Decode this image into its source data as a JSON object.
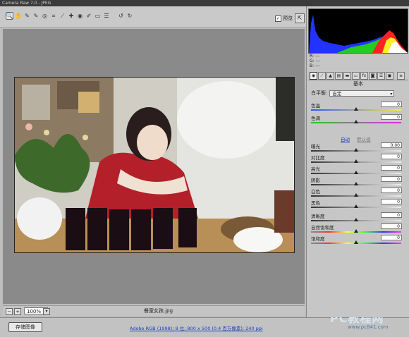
{
  "app": {
    "title": "Camera Raw 7.0 - JPEG"
  },
  "toolbar": {
    "tools": [
      {
        "icon": "zoom-icon",
        "glyph": "🔍",
        "selected": true
      },
      {
        "icon": "hand-icon",
        "glyph": "✋"
      },
      {
        "icon": "white-balance-icon",
        "glyph": "✎"
      },
      {
        "icon": "color-sampler-icon",
        "glyph": "✎"
      },
      {
        "icon": "target-adjust-icon",
        "glyph": "◎"
      },
      {
        "icon": "crop-icon",
        "glyph": "⌗"
      },
      {
        "icon": "straighten-icon",
        "glyph": "⟋"
      },
      {
        "icon": "spot-removal-icon",
        "glyph": "✚"
      },
      {
        "icon": "red-eye-icon",
        "glyph": "◉"
      },
      {
        "icon": "adjustment-brush-icon",
        "glyph": "✐"
      },
      {
        "icon": "graduated-filter-icon",
        "glyph": "▭"
      },
      {
        "icon": "preferences-icon",
        "glyph": "☰"
      },
      {
        "icon": "rotate-ccw-icon",
        "glyph": "↺"
      },
      {
        "icon": "rotate-cw-icon",
        "glyph": "↻"
      }
    ],
    "preview_label": "预览",
    "preview_checked": true
  },
  "status": {
    "zoom": "100%",
    "filename": "餐室女孩.jpg",
    "workflow_link": "Adobe RGB (1998); 8 位; 800 x 500 (0.4 百万像素); 240 ppi",
    "save_button": "存储图像"
  },
  "panel": {
    "rgb": {
      "r_label": "R:",
      "g_label": "G:",
      "b_label": "B:",
      "r": "---",
      "g": "---",
      "b": "---"
    },
    "section_title": "基本",
    "white_balance_label": "白平衡:",
    "white_balance_value": "自定",
    "auto_label": "自动",
    "default_label": "默认值",
    "sliders_wb": [
      {
        "label": "色温",
        "value": "0",
        "pos": 0.5
      },
      {
        "label": "色调",
        "value": "0",
        "pos": 0.5
      }
    ],
    "sliders_tone": [
      {
        "label": "曝光",
        "value": "0.00",
        "pos": 0.5
      },
      {
        "label": "对比度",
        "value": "0",
        "pos": 0.5
      },
      {
        "label": "高光",
        "value": "0",
        "pos": 0.5
      },
      {
        "label": "阴影",
        "value": "0",
        "pos": 0.5
      },
      {
        "label": "白色",
        "value": "0",
        "pos": 0.5
      },
      {
        "label": "黑色",
        "value": "0",
        "pos": 0.5
      }
    ],
    "sliders_presence": [
      {
        "label": "清晰度",
        "value": "0",
        "pos": 0.5
      },
      {
        "label": "自然饱和度",
        "value": "0",
        "pos": 0.5
      },
      {
        "label": "饱和度",
        "value": "0",
        "pos": 0.5
      }
    ]
  },
  "watermark": {
    "big": "PC教程网",
    "small": "www.pc841.com"
  },
  "colors": {
    "canvas": "#8a8a8a",
    "panel": "#c6c6c6",
    "link": "#1c3fbf"
  }
}
